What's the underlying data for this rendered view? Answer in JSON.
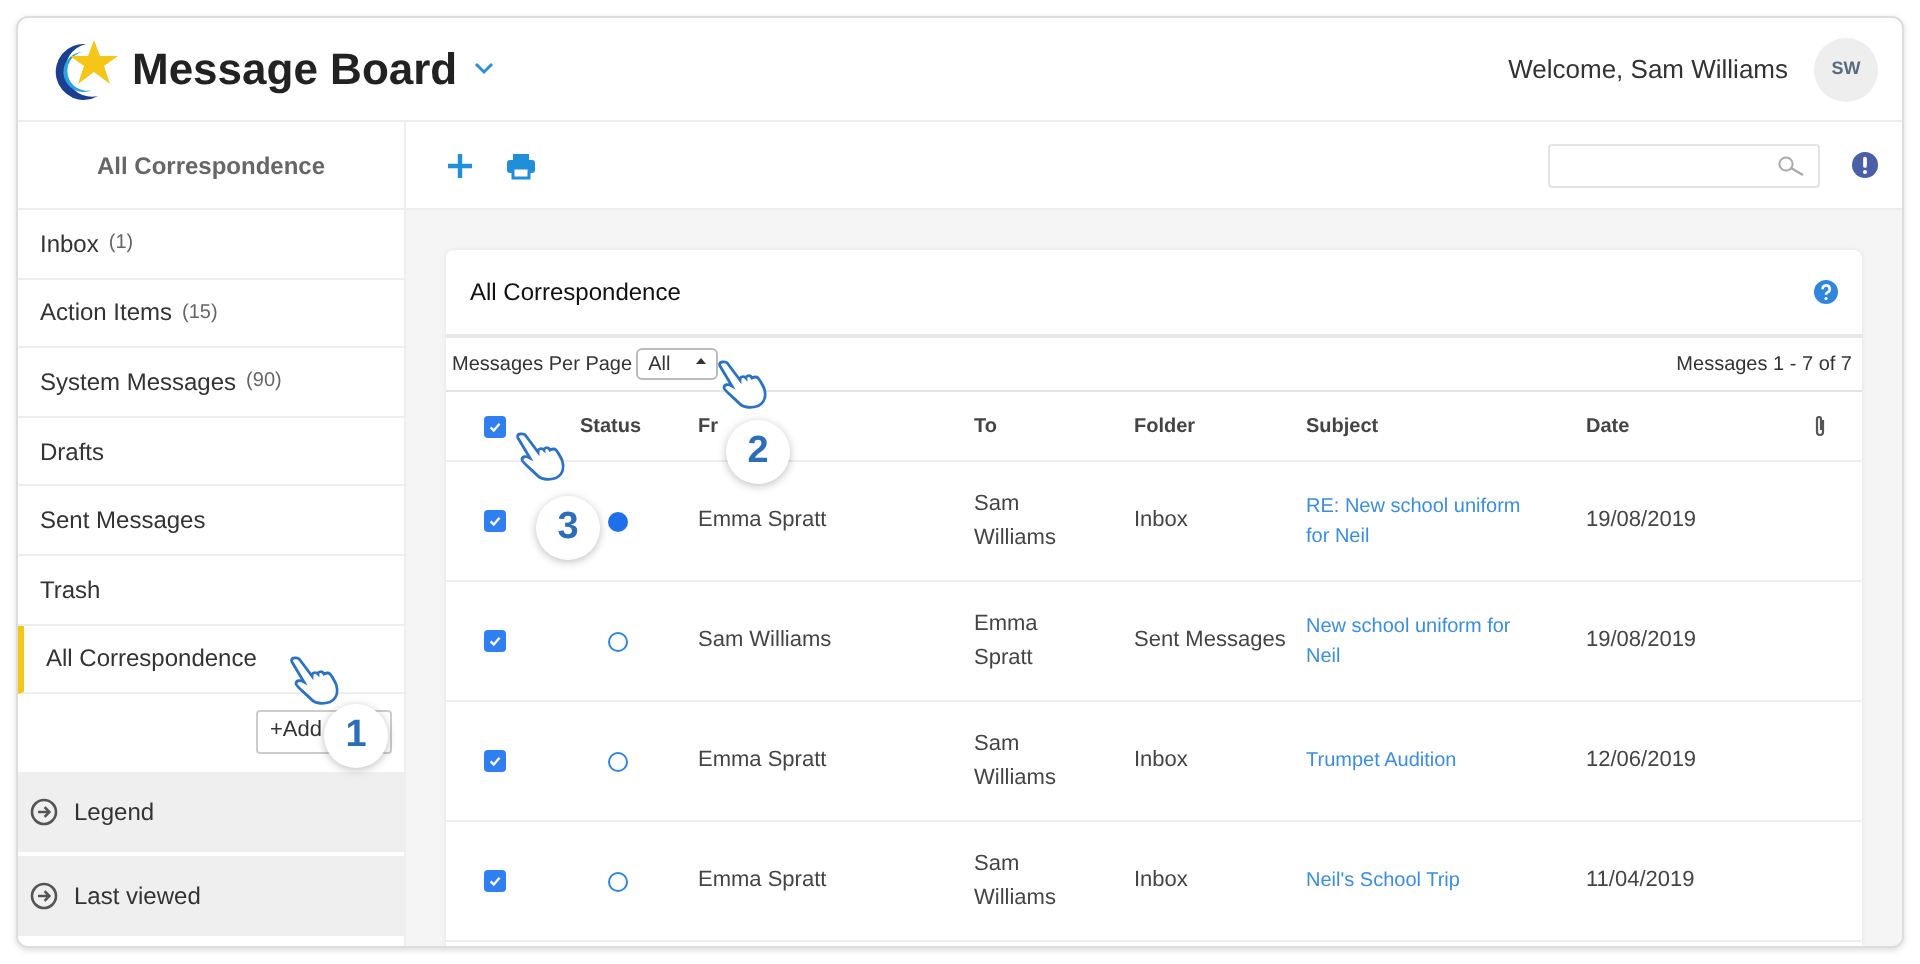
{
  "app": {
    "title": "Message Board",
    "welcome": "Welcome, Sam Williams",
    "avatar": "SW"
  },
  "sidebar": {
    "title": "All Correspondence",
    "items": [
      {
        "label": "Inbox",
        "count": "(1)",
        "selected": false
      },
      {
        "label": "Action Items",
        "count": "(15)",
        "selected": false
      },
      {
        "label": "System Messages",
        "count": "(90)",
        "selected": false
      },
      {
        "label": "Drafts",
        "selected": false
      },
      {
        "label": "Sent Messages",
        "selected": false
      },
      {
        "label": "Trash",
        "selected": false
      },
      {
        "label": "All Correspondence",
        "selected": true
      }
    ],
    "add_button": "+Add",
    "panels": [
      "Legend",
      "Last viewed"
    ]
  },
  "card": {
    "title": "All Correspondence",
    "per_page_label": "Messages Per Page",
    "per_page_value": "All",
    "range": "Messages 1 - 7 of 7"
  },
  "table": {
    "select_all_checked": true,
    "columns": [
      "Status",
      "Fr",
      "To",
      "Folder",
      "Subject",
      "Date"
    ],
    "rows": [
      {
        "checked": true,
        "unread": true,
        "from": "Emma Spratt",
        "to": "Sam Williams",
        "folder": "Inbox",
        "subject": "RE: New school uniform for Neil",
        "date": "19/08/2019"
      },
      {
        "checked": true,
        "unread": false,
        "from": "Sam Williams",
        "to": "Emma Spratt",
        "folder": "Sent Messages",
        "subject": "New school uniform for Neil",
        "date": "19/08/2019"
      },
      {
        "checked": true,
        "unread": false,
        "from": "Emma Spratt",
        "to": "Sam Williams",
        "folder": "Inbox",
        "subject": "Trumpet Audition",
        "date": "12/06/2019"
      },
      {
        "checked": true,
        "unread": false,
        "from": "Emma Spratt",
        "to": "Sam Williams",
        "folder": "Inbox",
        "subject": "Neil's School Trip",
        "date": "11/04/2019"
      }
    ]
  },
  "callouts": [
    "1",
    "2",
    "3"
  ]
}
